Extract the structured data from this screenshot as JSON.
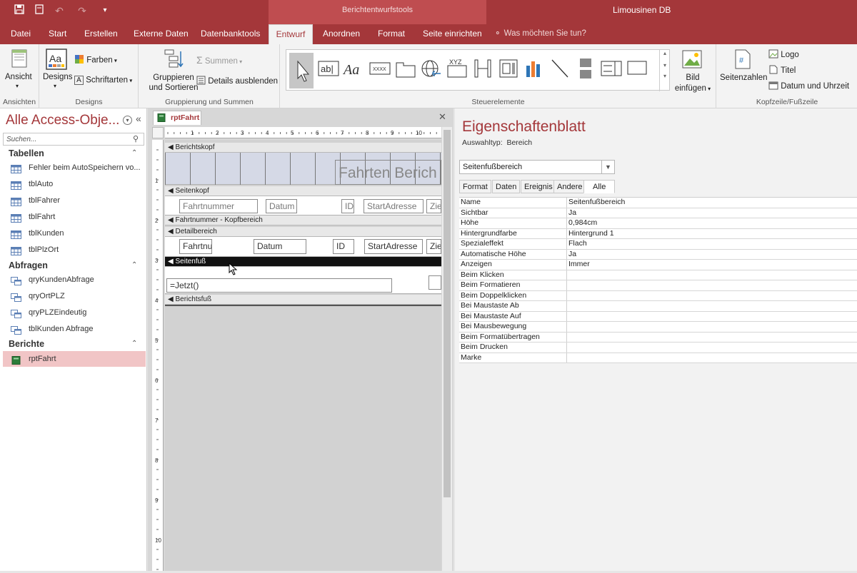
{
  "title_bar": {
    "context_tools": "Berichtentwurfstools",
    "app_title": "Limousinen DB"
  },
  "ribbon_tabs": [
    "Datei",
    "Start",
    "Erstellen",
    "Externe Daten",
    "Datenbanktools",
    "Entwurf",
    "Anordnen",
    "Format",
    "Seite einrichten"
  ],
  "active_tab": "Entwurf",
  "tell_me": "Was möchten Sie tun?",
  "ribbon": {
    "ansichten_btn": "Ansicht",
    "ansichten_label": "Ansichten",
    "designs_btn": "Designs",
    "farben_btn": "Farben",
    "schriftarten_btn": "Schriftarten",
    "designs_label": "Designs",
    "gruppieren_btn": "Gruppieren\nund Sortieren",
    "gruppieren_line1": "Gruppieren",
    "gruppieren_line2": "und Sortieren",
    "summen_btn": "Summen",
    "details_btn": "Details ausblenden",
    "gruppierung_label": "Gruppierung und Summen",
    "steuerelemente_label": "Steuerelemente",
    "bild_line1": "Bild",
    "bild_line2": "einfügen",
    "seitenzahlen_btn": "Seitenzahlen",
    "logo_btn": "Logo",
    "titel_btn": "Titel",
    "datum_btn": "Datum und Uhrzeit",
    "kopfzeile_label": "Kopfzeile/Fußzeile"
  },
  "nav": {
    "title": "Alle Access-Obje...",
    "search_placeholder": "Suchen...",
    "categories": [
      {
        "name": "Tabellen",
        "items": [
          "Fehler beim AutoSpeichern vo...",
          "tblAuto",
          "tblFahrer",
          "tblFahrt",
          "tblKunden",
          "tblPlzOrt"
        ]
      },
      {
        "name": "Abfragen",
        "items": [
          "qryKundenAbfrage",
          "qryOrtPLZ",
          "qryPLZEindeutig",
          "tblKunden Abfrage"
        ]
      },
      {
        "name": "Berichte",
        "items": [
          "rptFahrt"
        ]
      }
    ],
    "selected_item": "rptFahrt"
  },
  "document": {
    "tab": "rptFahrt",
    "ruler_numbers": [
      "1",
      "2",
      "3",
      "4",
      "5",
      "6",
      "7",
      "8",
      "9",
      "10"
    ],
    "sections": {
      "berichtskopf": "Berichtskopf",
      "seitenkopf": "Seitenkopf",
      "fahrtnummer_kopf": "Fahrtnummer - Kopfbereich",
      "detailbereich": "Detailbereich",
      "seitenfuss": "Seitenfuß",
      "berichtsfuss": "Berichtsfuß"
    },
    "controls": {
      "report_title": "Fahrten Berich",
      "h_fahrtnummer": "Fahrtnummer",
      "h_datum": "Datum",
      "h_id": "ID",
      "h_startadresse": "StartAdresse",
      "h_zie": "Zie",
      "d_fahrtnr": "Fahrtnu",
      "d_datum": "Datum",
      "d_id": "ID",
      "d_startadresse": "StartAdresse",
      "d_zie": "Zie",
      "f_jetzt": "=Jetzt()"
    }
  },
  "property_sheet": {
    "title": "Eigenschaftenblatt",
    "selection_type_label": "Auswahltyp:",
    "selection_type_value": "Bereich",
    "dropdown_value": "Seitenfußbereich",
    "tabs": [
      "Format",
      "Daten",
      "Ereignis",
      "Andere",
      "Alle"
    ],
    "active_tab": "Alle",
    "properties": [
      {
        "name": "Name",
        "value": "Seitenfußbereich"
      },
      {
        "name": "Sichtbar",
        "value": "Ja"
      },
      {
        "name": "Höhe",
        "value": "0,984cm"
      },
      {
        "name": "Hintergrundfarbe",
        "value": "Hintergrund 1"
      },
      {
        "name": "Spezialeffekt",
        "value": "Flach"
      },
      {
        "name": "Automatische Höhe",
        "value": "Ja"
      },
      {
        "name": "Anzeigen",
        "value": "Immer"
      },
      {
        "name": "Beim Klicken",
        "value": ""
      },
      {
        "name": "Beim Formatieren",
        "value": ""
      },
      {
        "name": "Beim Doppelklicken",
        "value": ""
      },
      {
        "name": "Bei Maustaste Ab",
        "value": ""
      },
      {
        "name": "Bei Maustaste Auf",
        "value": ""
      },
      {
        "name": "Bei Mausbewegung",
        "value": ""
      },
      {
        "name": "Beim Formatübertragen",
        "value": ""
      },
      {
        "name": "Beim Drucken",
        "value": ""
      },
      {
        "name": "Marke",
        "value": ""
      }
    ]
  },
  "colors": {
    "accent": "#a4373a",
    "context_band": "#bf4d50",
    "selected_nav": "#f1c5c6"
  }
}
